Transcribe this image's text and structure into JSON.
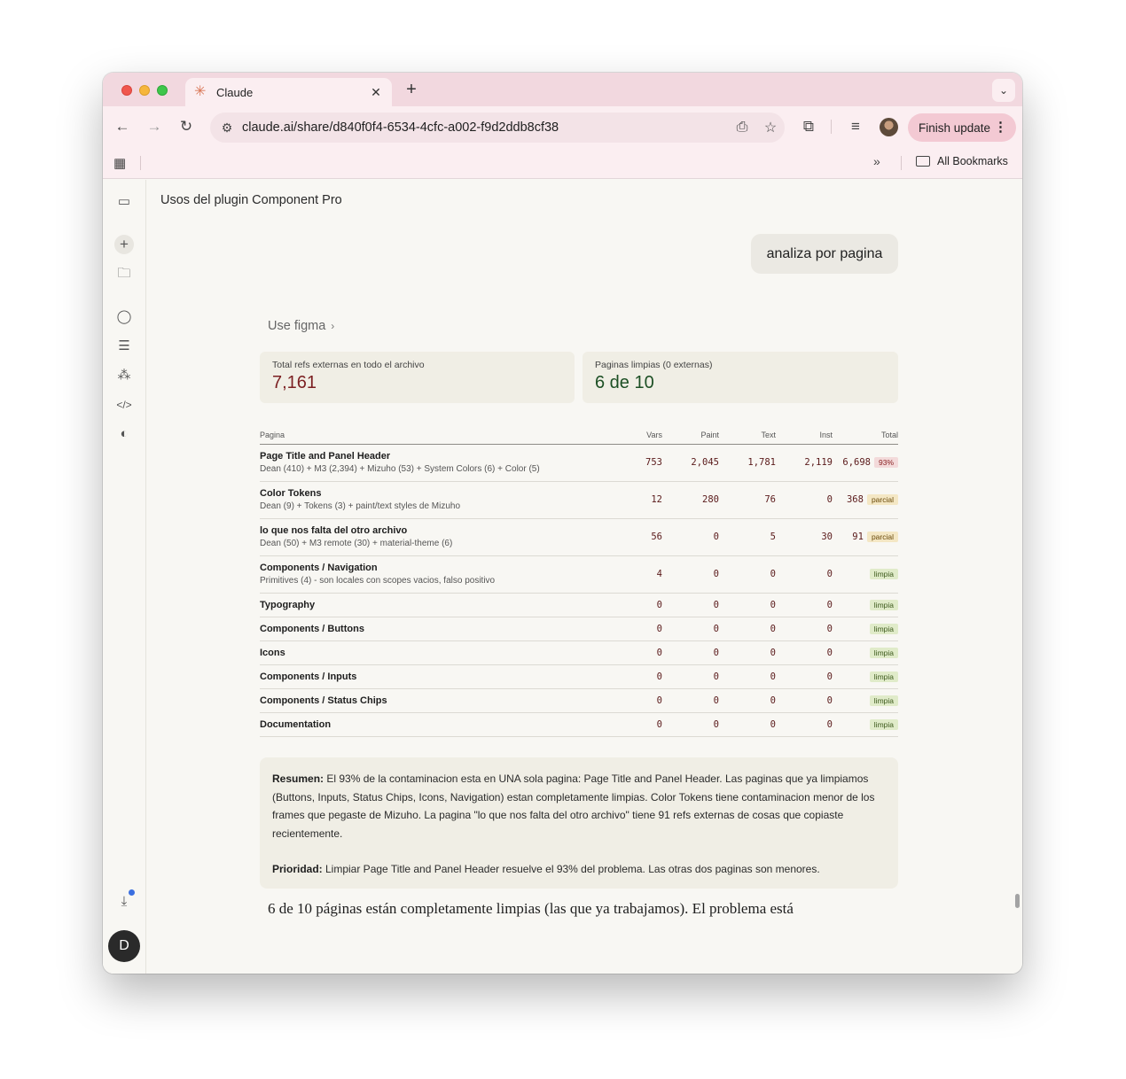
{
  "browser": {
    "tab": {
      "title": "Claude",
      "favicon": "claude-sparkle-icon"
    },
    "url": "claude.ai/share/d840f0f4-6534-4cfc-a002-f9d2ddb8cf38",
    "finish_update_label": "Finish update",
    "bookmarks": {
      "all_label": "All Bookmarks"
    }
  },
  "sidebar": {
    "icons": [
      "sidebar-toggle-icon",
      "new-chat-icon",
      "projects-icon",
      "chats-icon",
      "archive-icon",
      "artifacts-icon",
      "code-icon",
      "palette-icon",
      "download-icon"
    ],
    "user_initial": "D"
  },
  "conversation": {
    "title": "Usos del plugin Component Pro",
    "user_message": "analiza por pagina",
    "tool_label": "Use figma"
  },
  "stats": {
    "refs": {
      "label": "Total refs externas en todo el archivo",
      "value": "7,161"
    },
    "clean": {
      "label": "Paginas limpias (0 externas)",
      "value": "6 de 10"
    }
  },
  "table": {
    "headers": [
      "Pagina",
      "Vars",
      "Paint",
      "Text",
      "Inst",
      "Total"
    ],
    "rows": [
      {
        "name": "Page Title and Panel Header",
        "sub": "Dean (410) + M3 (2,394) + Mizuho (53) + System Colors (6) + Color (5)",
        "vars": "753",
        "paint": "2,045",
        "text": "1,781",
        "inst": "2,119",
        "total": "6,698",
        "badge": "93%",
        "status": "red"
      },
      {
        "name": "Color Tokens",
        "sub": "Dean (9) + Tokens (3) + paint/text styles de Mizuho",
        "vars": "12",
        "paint": "280",
        "text": "76",
        "inst": "0",
        "total": "368",
        "badge": "parcial",
        "status": "amber"
      },
      {
        "name": "lo que nos falta del otro archivo",
        "sub": "Dean (50) + M3 remote (30) + material-theme (6)",
        "vars": "56",
        "paint": "0",
        "text": "5",
        "inst": "30",
        "total": "91",
        "badge": "parcial",
        "status": "amber"
      },
      {
        "name": "Components / Navigation",
        "sub": "Primitives (4) - son locales con scopes vacios, falso positivo",
        "vars": "4",
        "paint": "0",
        "text": "0",
        "inst": "0",
        "total": "",
        "badge": "limpia",
        "status": "green"
      },
      {
        "name": "Typography",
        "sub": "",
        "vars": "0",
        "paint": "0",
        "text": "0",
        "inst": "0",
        "total": "",
        "badge": "limpia",
        "status": "green"
      },
      {
        "name": "Components / Buttons",
        "sub": "",
        "vars": "0",
        "paint": "0",
        "text": "0",
        "inst": "0",
        "total": "",
        "badge": "limpia",
        "status": "green"
      },
      {
        "name": "Icons",
        "sub": "",
        "vars": "0",
        "paint": "0",
        "text": "0",
        "inst": "0",
        "total": "",
        "badge": "limpia",
        "status": "green"
      },
      {
        "name": "Components / Inputs",
        "sub": "",
        "vars": "0",
        "paint": "0",
        "text": "0",
        "inst": "0",
        "total": "",
        "badge": "limpia",
        "status": "green"
      },
      {
        "name": "Components / Status Chips",
        "sub": "",
        "vars": "0",
        "paint": "0",
        "text": "0",
        "inst": "0",
        "total": "",
        "badge": "limpia",
        "status": "green"
      },
      {
        "name": "Documentation",
        "sub": "",
        "vars": "0",
        "paint": "0",
        "text": "0",
        "inst": "0",
        "total": "",
        "badge": "limpia",
        "status": "green"
      }
    ]
  },
  "summary": {
    "resumen_label": "Resumen:",
    "resumen_text": " El 93% de la contaminacion esta en UNA sola pagina: Page Title and Panel Header. Las paginas que ya limpiamos (Buttons, Inputs, Status Chips, Icons, Navigation) estan completamente limpias. Color Tokens tiene contaminacion menor de los frames que pegaste de Mizuho. La pagina \"lo que nos falta del otro archivo\" tiene 91 refs externas de cosas que copiaste recientemente.",
    "prioridad_label": "Prioridad:",
    "prioridad_text": " Limpiar Page Title and Panel Header resuelve el 93% del problema. Las otras dos paginas son menores."
  },
  "final_text": "6 de 10 páginas están completamente limpias (las que ya trabajamos). El problema está",
  "colors": {
    "accent_red": "#7b1f21",
    "accent_green": "#1c4f24",
    "tab_strip": "#f2d8df"
  }
}
